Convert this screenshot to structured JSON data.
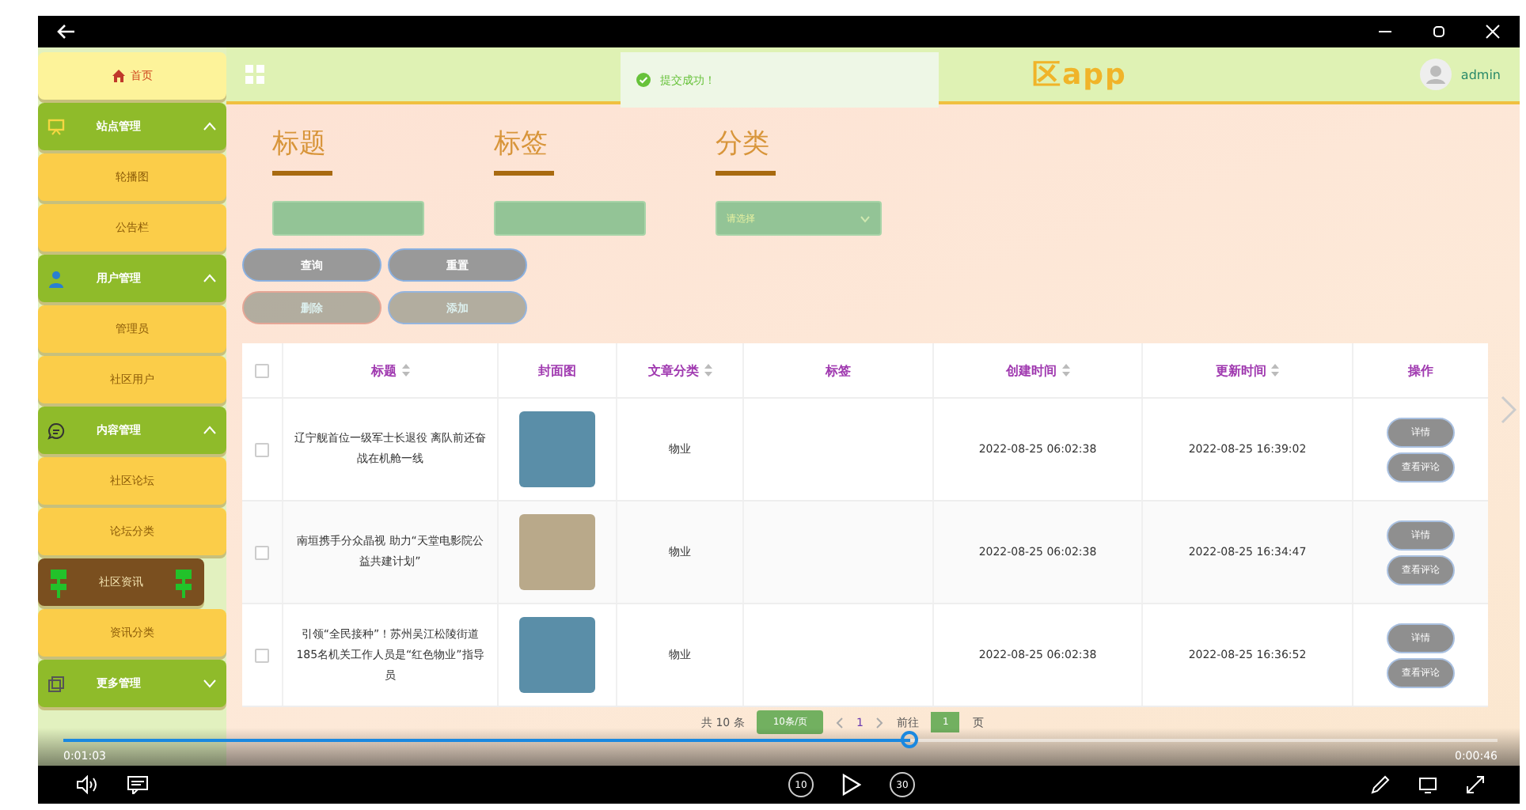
{
  "sidebar": {
    "home": {
      "label": "首页"
    },
    "groups": [
      {
        "label": "站点管理",
        "expanded": true,
        "children": [
          {
            "label": "轮播图",
            "selected": false
          },
          {
            "label": "公告栏",
            "selected": false
          }
        ]
      },
      {
        "label": "用户管理",
        "expanded": true,
        "children": [
          {
            "label": "管理员",
            "selected": false
          },
          {
            "label": "社区用户",
            "selected": false
          }
        ]
      },
      {
        "label": "内容管理",
        "expanded": true,
        "children": [
          {
            "label": "社区论坛",
            "selected": false
          },
          {
            "label": "论坛分类",
            "selected": false
          },
          {
            "label": "社区资讯",
            "selected": true
          },
          {
            "label": "资讯分类",
            "selected": false
          }
        ]
      },
      {
        "label": "更多管理",
        "expanded": false
      }
    ]
  },
  "header": {
    "title": "区app",
    "user": "admin"
  },
  "toast": {
    "message": "提交成功！"
  },
  "search": {
    "fields": [
      {
        "label": "标题",
        "kind": "input"
      },
      {
        "label": "标签",
        "kind": "input"
      },
      {
        "label": "分类",
        "kind": "select",
        "placeholder": "请选择"
      }
    ],
    "buttons": [
      {
        "label": "查询",
        "disabled": false
      },
      {
        "label": "重置",
        "disabled": false
      },
      {
        "label": "删除",
        "disabled": true
      },
      {
        "label": "添加",
        "disabled": true
      }
    ]
  },
  "table": {
    "select_all": {
      "checked": false
    },
    "columns": [
      {
        "label": "标题",
        "sortable": true
      },
      {
        "label": "封面图",
        "sortable": false
      },
      {
        "label": "文章分类",
        "sortable": true
      },
      {
        "label": "标签",
        "sortable": false
      },
      {
        "label": "创建时间",
        "sortable": true
      },
      {
        "label": "更新时间",
        "sortable": true
      },
      {
        "label": "操作",
        "sortable": false
      }
    ],
    "rows": [
      {
        "checked": false,
        "title": "辽宁舰首位一级军士长退役 离队前还奋战在机舱一线",
        "category": "物业",
        "created": "2022-08-25 06:02:38",
        "updated": "2022-08-25 16:39:02",
        "actions": [
          "详情",
          "查看评论"
        ]
      },
      {
        "checked": false,
        "title": "南垣携手分众晶视 助力“天堂电影院公益共建计划”",
        "category": "物业",
        "created": "2022-08-25 06:02:38",
        "updated": "2022-08-25 16:34:47",
        "actions": [
          "详情",
          "查看评论"
        ]
      },
      {
        "checked": false,
        "title": "引领“全民接种”！苏州吴江松陵街道185名机关工作人员是“红色物业”指导员",
        "category": "物业",
        "created": "2022-08-25 06:02:38",
        "updated": "2022-08-25 16:36:52",
        "actions": [
          "详情",
          "查看评论"
        ]
      }
    ]
  },
  "pagination": {
    "total": "共 10 条",
    "page_size": "10条/页",
    "current": "1",
    "goto_label": "前往",
    "goto_value": "1",
    "page_suffix": "页"
  },
  "player": {
    "elapsed": "0:01:03",
    "remaining": "0:00:46",
    "progress": {
      "level": 0.59
    },
    "rewind": "10",
    "forward": "30"
  }
}
